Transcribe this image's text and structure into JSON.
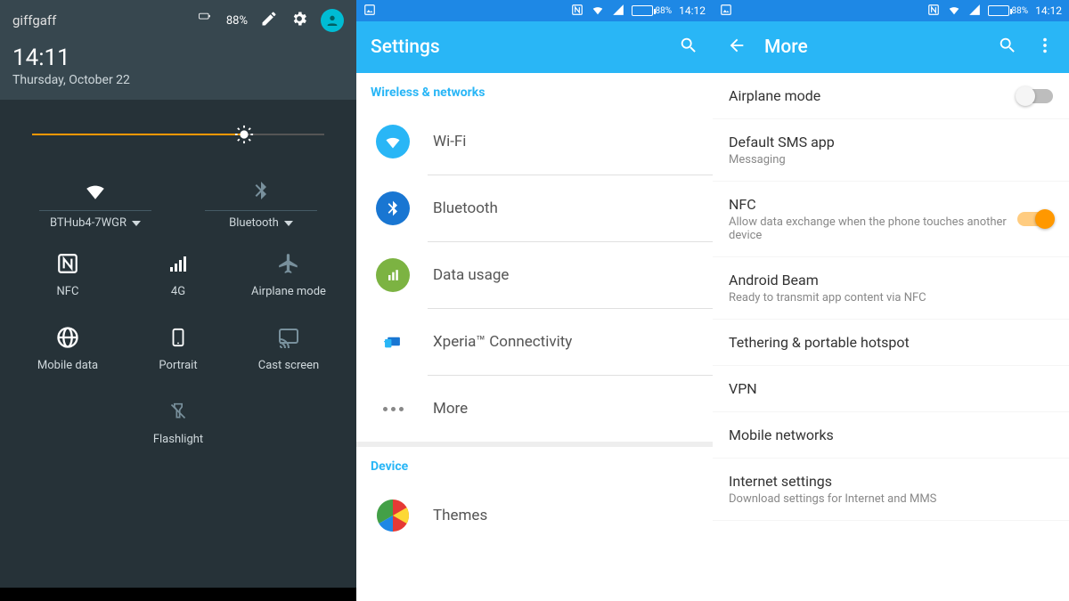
{
  "qs": {
    "carrier": "giffgaff",
    "battery": "88%",
    "time": "14:11",
    "date": "Thursday, October 22",
    "brightness_pct": 64,
    "tiles_top": [
      {
        "label": "BTHub4-7WGR"
      },
      {
        "label": "Bluetooth"
      }
    ],
    "tiles": [
      {
        "label": "NFC"
      },
      {
        "label": "4G"
      },
      {
        "label": "Airplane mode"
      },
      {
        "label": "Mobile data"
      },
      {
        "label": "Portrait"
      },
      {
        "label": "Cast screen"
      },
      {
        "label": "Flashlight"
      }
    ]
  },
  "settings": {
    "status_time": "14:12",
    "status_batt": "88%",
    "title": "Settings",
    "section1": "Wireless & networks",
    "rows": [
      {
        "label": "Wi-Fi"
      },
      {
        "label": "Bluetooth"
      },
      {
        "label": "Data usage"
      },
      {
        "label": "Xperia™ Connectivity"
      },
      {
        "label": "More"
      }
    ],
    "section2": "Device",
    "device_rows": [
      {
        "label": "Themes"
      }
    ]
  },
  "more": {
    "status_time": "14:12",
    "status_batt": "88%",
    "title": "More",
    "rows": [
      {
        "title": "Airplane mode",
        "sub": "",
        "switch": "off"
      },
      {
        "title": "Default SMS app",
        "sub": "Messaging"
      },
      {
        "title": "NFC",
        "sub": "Allow data exchange when the phone touches another device",
        "switch": "on"
      },
      {
        "title": "Android Beam",
        "sub": "Ready to transmit app content via NFC"
      },
      {
        "title": "Tethering & portable hotspot",
        "sub": ""
      },
      {
        "title": "VPN",
        "sub": ""
      },
      {
        "title": "Mobile networks",
        "sub": ""
      },
      {
        "title": "Internet settings",
        "sub": "Download settings for Internet and MMS"
      }
    ]
  }
}
